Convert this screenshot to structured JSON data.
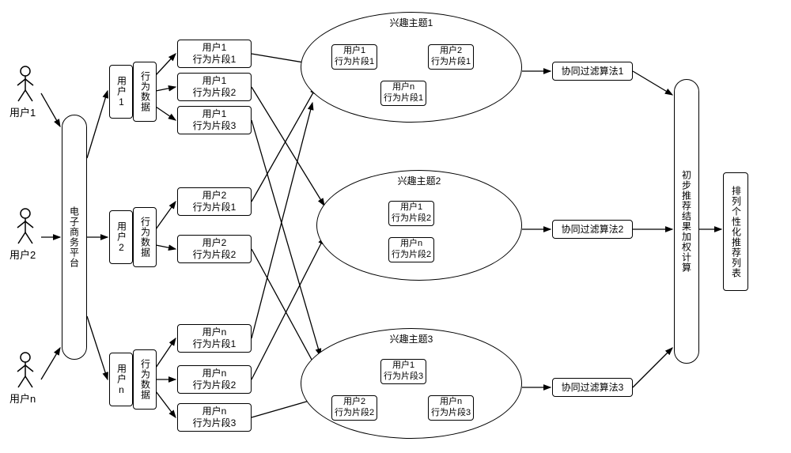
{
  "users": {
    "u1": "用户1",
    "u2": "用户2",
    "un": "用户n"
  },
  "platform": "电子商务平台",
  "userCol": {
    "u1": "用户1",
    "u2": "用户2",
    "un": "用户n"
  },
  "behaviorData": "行为数据",
  "segments": {
    "u1s1": "用户1\n行为片段1",
    "u1s2": "用户1\n行为片段2",
    "u1s3": "用户1\n行为片段3",
    "u2s1": "用户2\n行为片段1",
    "u2s2": "用户2\n行为片段2",
    "uns1": "用户n\n行为片段1",
    "uns2": "用户n\n行为片段2",
    "uns3": "用户n\n行为片段3"
  },
  "topics": {
    "t1": {
      "title": "兴趣主题1",
      "b1": "用户1\n行为片段1",
      "b2": "用户2\n行为片段1",
      "b3": "用户n\n行为片段1"
    },
    "t2": {
      "title": "兴趣主题2",
      "b1": "用户1\n行为片段2",
      "b2": "用户n\n行为片段2"
    },
    "t3": {
      "title": "兴趣主题3",
      "b1": "用户1\n行为片段3",
      "b2": "用户2\n行为片段2",
      "b3": "用户n\n行为片段3"
    }
  },
  "algos": {
    "a1": "协同过滤算法1",
    "a2": "协同过滤算法2",
    "a3": "协同过滤算法3"
  },
  "weighted": "初步推荐结果加权计算",
  "final": "排列个性化推荐列表"
}
